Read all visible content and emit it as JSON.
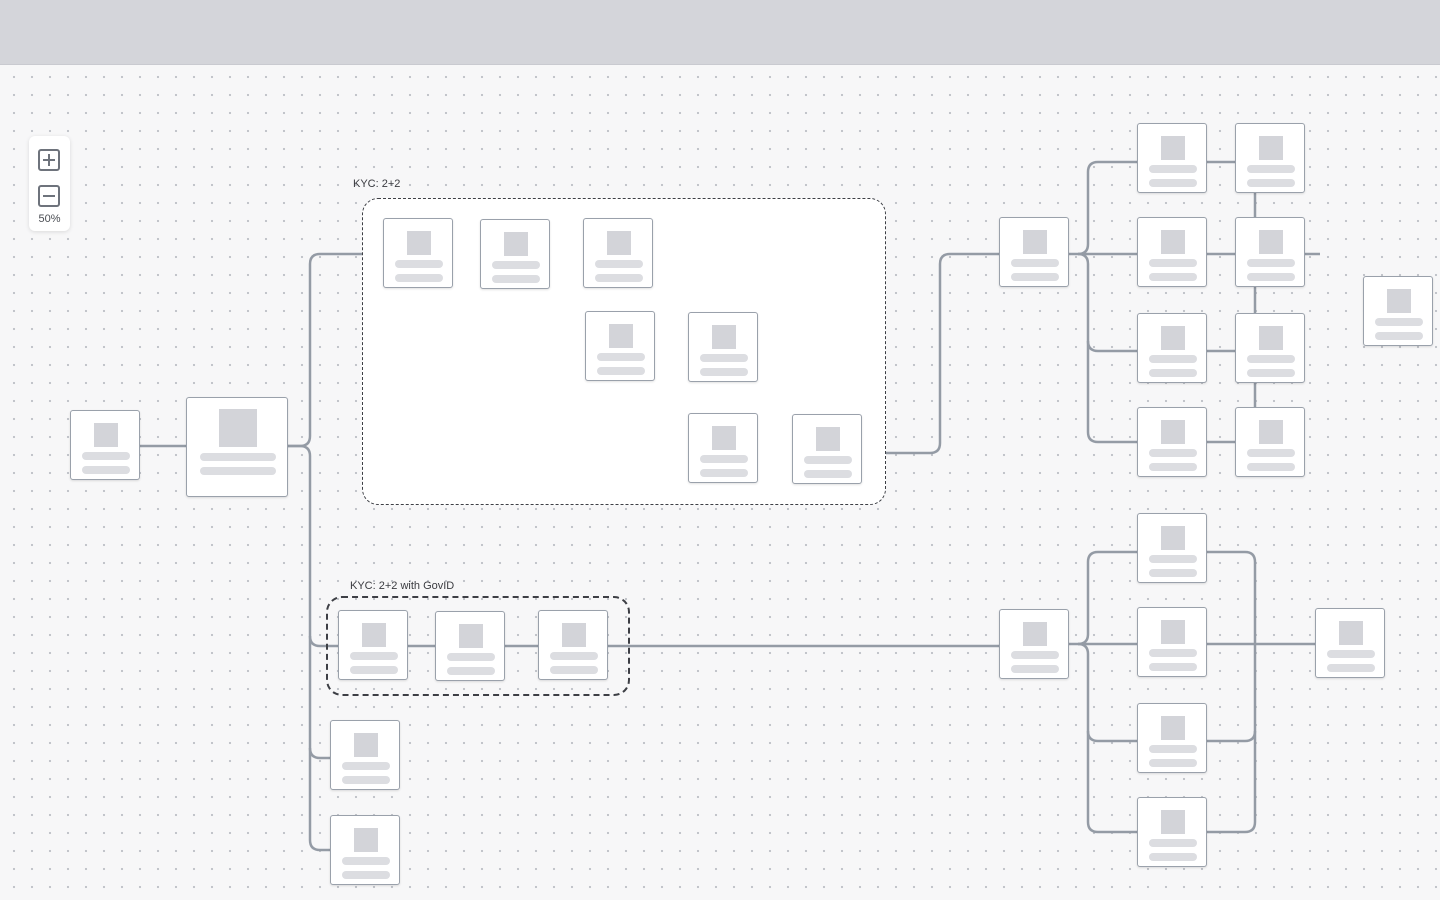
{
  "toolbar": {},
  "zoom": {
    "level": "50%",
    "zoom_in_icon": "plus-square-icon",
    "zoom_out_icon": "minus-square-icon"
  },
  "groups": {
    "kyc_basic": {
      "label": "KYC: 2+2"
    },
    "kyc_govid": {
      "label": "KYC: 2+2 with GovID"
    }
  },
  "colors": {
    "topbar": "#d4d5da",
    "canvas": "#f7f7f8",
    "edge": "#949ba5",
    "node_border": "#9aa1ab",
    "placeholder": "#d3d4d9"
  }
}
